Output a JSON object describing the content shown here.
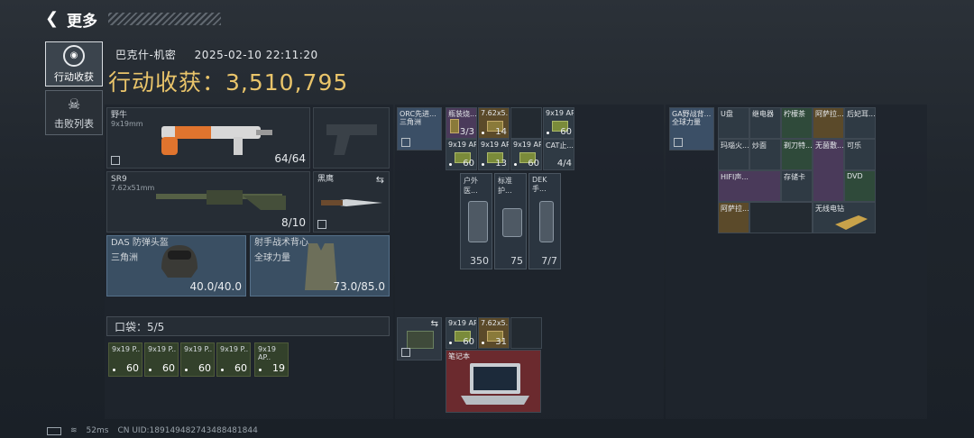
{
  "topbar": {
    "title": "更多"
  },
  "tabs": [
    {
      "label": "行动收获"
    },
    {
      "label": "击败列表"
    }
  ],
  "header": {
    "map": "巴克什-机密",
    "datetime": "2025-02-10 22:11:20",
    "gain_label": "行动收获：",
    "gain_value": "3,510,795"
  },
  "loadout": {
    "primary": {
      "name": "野牛",
      "caliber": "9x19mm",
      "ammo": "64/64"
    },
    "secondary": {
      "name": "SR9",
      "caliber": "7.62x51mm",
      "ammo": "8/10"
    },
    "knife": {
      "name": "黑鹰"
    },
    "helmet": {
      "name": "DAS 防弹头盔",
      "brand": "三角洲",
      "durability": "40.0/40.0"
    },
    "vest": {
      "name": "射手战术背心",
      "brand": "全球力量",
      "durability": "73.0/85.0"
    }
  },
  "pocket": {
    "label": "口袋：5/5",
    "items": [
      {
        "n": "9x19 P..",
        "c": "60"
      },
      {
        "n": "9x19 P..",
        "c": "60"
      },
      {
        "n": "9x19 P..",
        "c": "60"
      },
      {
        "n": "9x19 P..",
        "c": "60"
      },
      {
        "n": "9x19 AP..",
        "c": "19"
      }
    ]
  },
  "rig": {
    "title": "ORC先进...",
    "sub": "三角洲",
    "cells": [
      {
        "n": "瓶装烧...",
        "c": "3/3"
      },
      {
        "n": "7.62x5..",
        "c": "14"
      },
      {
        "n": "9x19 AP..",
        "c": "60"
      },
      {
        "n": "9x19 AP..",
        "c": "60"
      },
      {
        "n": "9x19 AP..",
        "c": "13"
      },
      {
        "n": "9x19 AP..",
        "c": "60"
      },
      {
        "n": "CAT止...",
        "c": "4/4"
      }
    ],
    "meds": [
      {
        "n": "户外医...",
        "c": "350"
      },
      {
        "n": "标准护...",
        "c": "75"
      },
      {
        "n": "DEK手...",
        "c": "7/7"
      }
    ]
  },
  "bag": {
    "cells": [
      {
        "n": "9x19 AP..",
        "c": "60"
      },
      {
        "n": "7.62x5.. M6..",
        "c": "31"
      }
    ],
    "laptop": "笔记本"
  },
  "backpack": {
    "title": "GA野战背...",
    "sub": "全球力量",
    "items": [
      {
        "n": "U盘"
      },
      {
        "n": "继电器"
      },
      {
        "n": "柠檬茶"
      },
      {
        "n": "阿萨拉..."
      },
      {
        "n": "后妃耳..."
      },
      {
        "n": "玛瑙火..."
      },
      {
        "n": "炒面"
      },
      {
        "n": "剃刀特..."
      },
      {
        "n": "无菌敷..."
      },
      {
        "n": "可乐"
      },
      {
        "n": "HIFI声..."
      },
      {
        "n": "存储卡"
      },
      {
        "n": "DVD"
      },
      {
        "n": "阿萨拉..."
      },
      {
        "n": "无线电钻"
      }
    ]
  },
  "footer": {
    "ping": "52ms",
    "uid": "CN UID:1891494827434884818​44"
  },
  "colors": {
    "gold": "#e9c46a",
    "armor": "#3a4f63",
    "laptop": "#6b2a2e"
  }
}
